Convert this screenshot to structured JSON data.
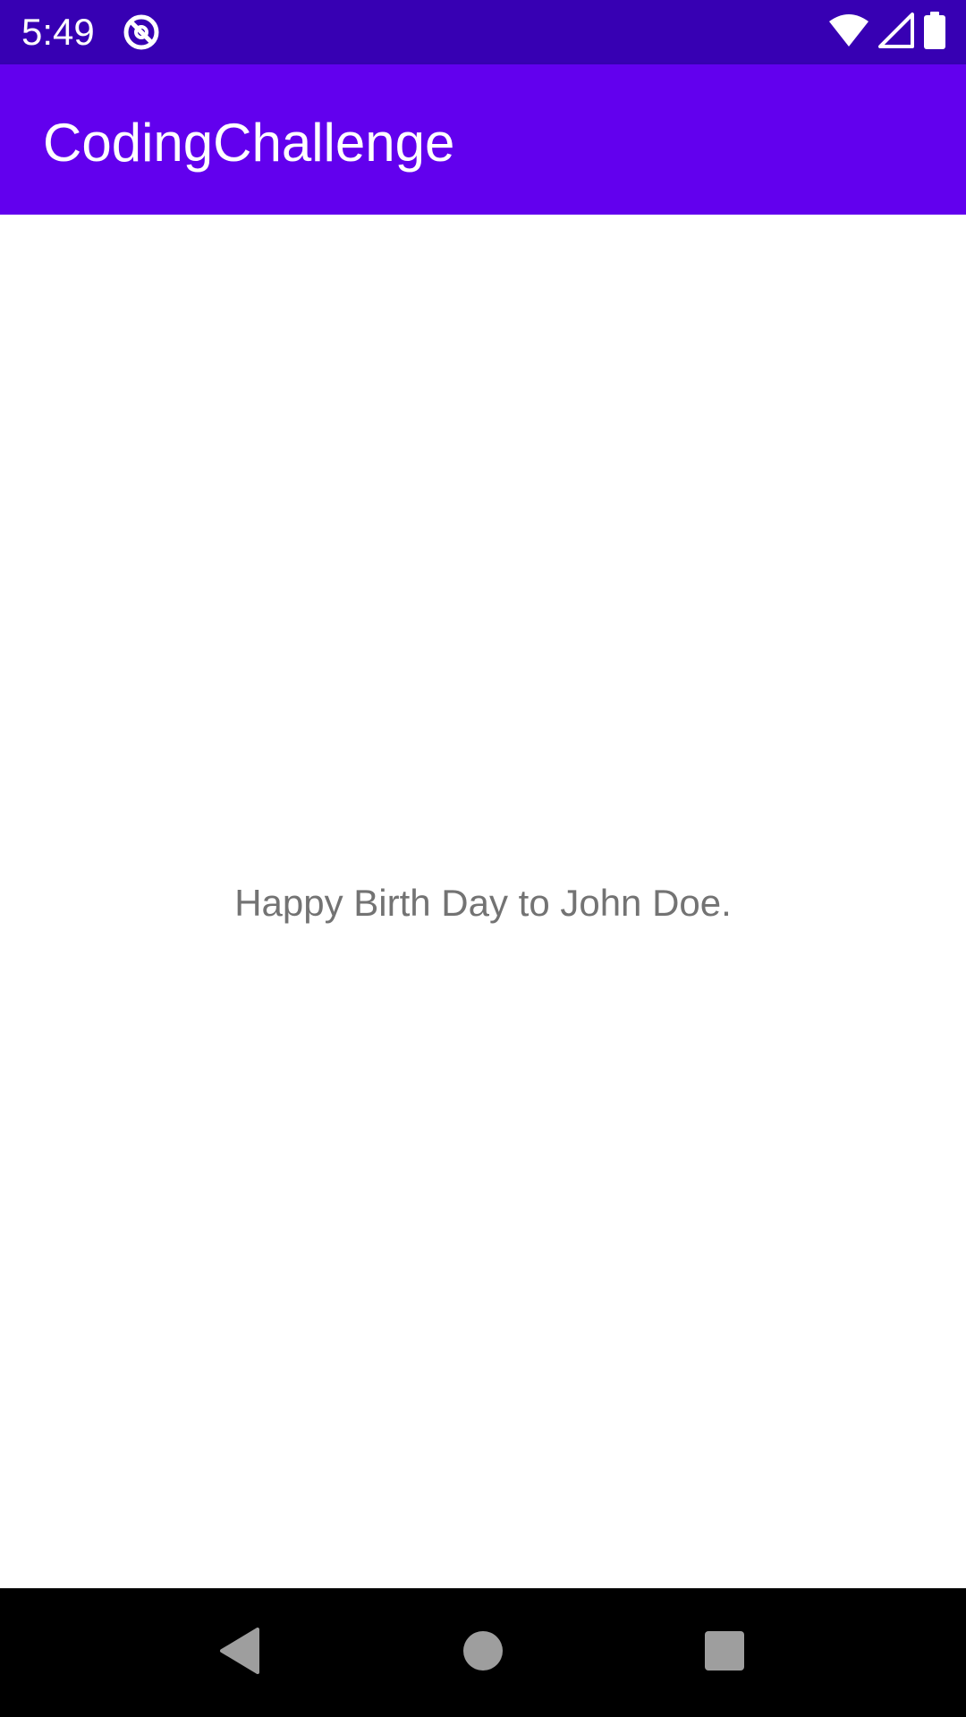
{
  "status_bar": {
    "time": "5:49",
    "app_icon": "circle-slash-icon",
    "wifi_icon": "wifi-icon",
    "signal_icon": "cell-signal-icon",
    "battery_icon": "battery-icon",
    "background": "#3700b3"
  },
  "app_bar": {
    "title": "CodingChallenge",
    "background": "#6200ee"
  },
  "main": {
    "greeting": "Happy Birth Day to John Doe."
  },
  "nav_bar": {
    "back_icon": "back-triangle-icon",
    "home_icon": "home-circle-icon",
    "recents_icon": "recents-square-icon"
  }
}
